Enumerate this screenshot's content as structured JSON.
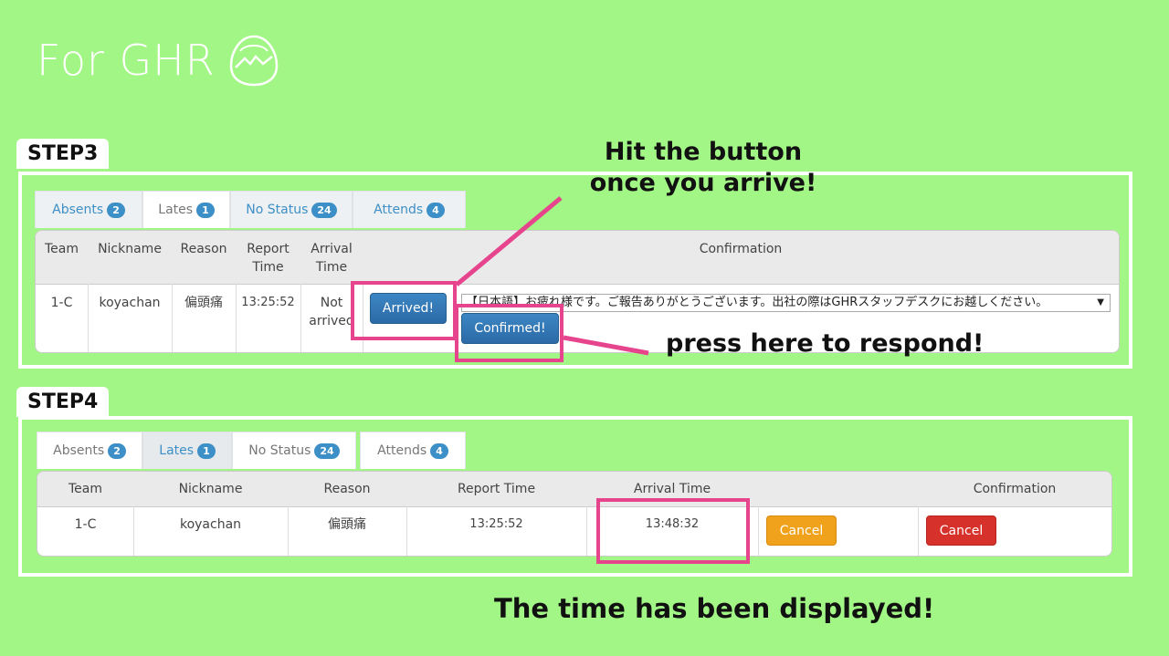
{
  "brand": {
    "title": "For GHR",
    "logo_icon": "egg-mountain-logo-icon"
  },
  "step3": {
    "label": "STEP3",
    "tabs": [
      {
        "label": "Absents",
        "count": "2"
      },
      {
        "label": "Lates",
        "count": "1"
      },
      {
        "label": "No Status",
        "count": "24"
      },
      {
        "label": "Attends",
        "count": "4"
      }
    ],
    "headers": {
      "team": "Team",
      "nickname": "Nickname",
      "reason": "Reason",
      "report_1": "Report",
      "report_2": "Time",
      "arrival_1": "Arrival",
      "arrival_2": "Time",
      "confirmation": "Confirmation"
    },
    "row": {
      "team": "1-C",
      "nickname": "koyachan",
      "reason": "偏頭痛",
      "report_time": "13:25:52",
      "arrival_1": "Not",
      "arrival_2": "arrived",
      "arrived_button": "Arrived!",
      "message_select": "【日本語】お疲れ様です。ご報告ありがとうございます。出社の際はGHRスタッフデスクにお越しください。",
      "confirmed_button": "Confirmed!"
    },
    "annotations": {
      "hit_1": "Hit the button",
      "hit_2": "once you arrive!",
      "press": "press here to respond!"
    }
  },
  "step4": {
    "label": "STEP4",
    "tabs": [
      {
        "label": "Absents",
        "count": "2"
      },
      {
        "label": "Lates",
        "count": "1"
      },
      {
        "label": "No Status",
        "count": "24"
      },
      {
        "label": "Attends",
        "count": "4"
      }
    ],
    "headers": {
      "team": "Team",
      "nickname": "Nickname",
      "reason": "Reason",
      "report": "Report Time",
      "arrival": "Arrival Time",
      "confirmation": "Confirmation"
    },
    "row": {
      "team": "1-C",
      "nickname": "koyachan",
      "reason": "偏頭痛",
      "report_time": "13:25:52",
      "arrival_time": "13:48:32",
      "cancel_orange": "Cancel",
      "cancel_red": "Cancel"
    },
    "annotation": "The time has been displayed!"
  },
  "colors": {
    "background": "#a2f685",
    "highlight": "#e6458d",
    "link_blue": "#3d8fc7"
  }
}
